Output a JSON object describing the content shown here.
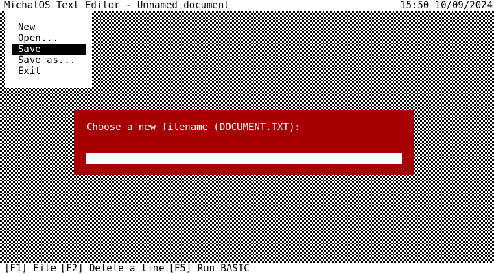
{
  "titlebar": {
    "title": "MichalOS Text Editor - Unnamed document",
    "clock": "15:50 10/09/2024"
  },
  "menu": {
    "items": [
      {
        "label": "New"
      },
      {
        "label": "Open..."
      },
      {
        "label": "Save",
        "selected": true
      },
      {
        "label": "Save as..."
      },
      {
        "label": "Exit"
      }
    ]
  },
  "dialog": {
    "prompt": "Choose a new filename (DOCUMENT.TXT):",
    "input_value": "",
    "cursor": "_"
  },
  "statusbar": {
    "hints": [
      {
        "label": "[F1] File"
      },
      {
        "label": "[F2] Delete a line"
      },
      {
        "label": "[F5] Run BASIC"
      }
    ]
  },
  "colors": {
    "dialog_bg": "#a80000",
    "selection_bg": "#000000"
  }
}
